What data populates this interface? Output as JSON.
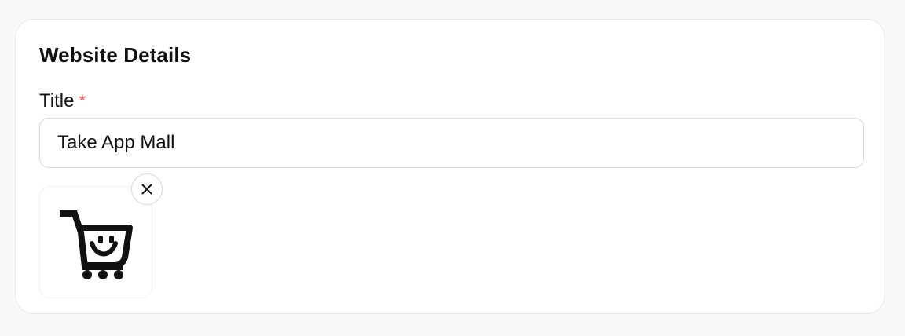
{
  "section": {
    "title": "Website Details"
  },
  "title_field": {
    "label": "Title",
    "required_mark": "*",
    "value": "Take App Mall"
  },
  "logo": {
    "icon": "shopping-cart-smile-icon",
    "remove_icon": "close-icon"
  },
  "colors": {
    "required": "#e5484d",
    "text": "#111111",
    "border": "#d5d7dc"
  }
}
